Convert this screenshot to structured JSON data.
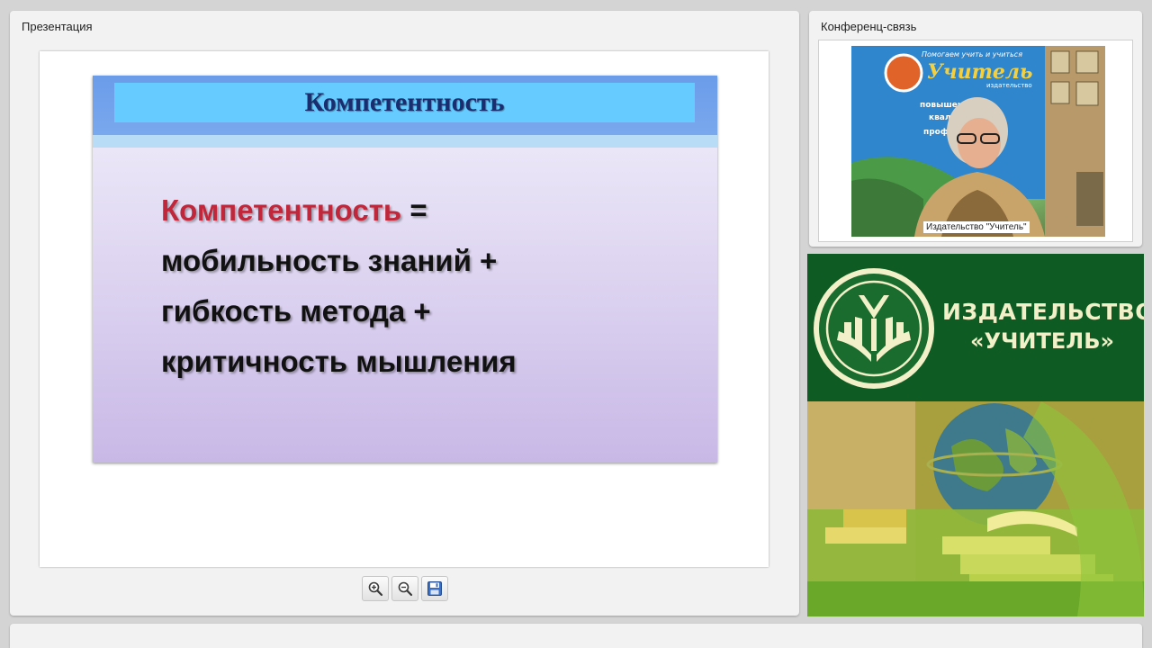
{
  "presentation": {
    "title": "Презентация",
    "slide": {
      "title": "Компетентность",
      "lines": [
        {
          "accent": "Компетентность",
          "text": " ="
        },
        {
          "text": "мобильность знаний +"
        },
        {
          "text": "гибкость метода +"
        },
        {
          "text": "критичность мышления"
        }
      ]
    },
    "toolbar": {
      "zoom_in_icon": "zoom-in-icon",
      "zoom_out_icon": "zoom-out-icon",
      "save_icon": "save-icon"
    }
  },
  "conference": {
    "title": "Конференц-связь",
    "caption": "Издательство \"Учитель\"",
    "backdrop_lines": [
      "Помогаем учить и учиться",
      "Учитель",
      "издательство",
      "повышение",
      "квали",
      "профе"
    ]
  },
  "banner": {
    "line1": "ИЗДАТЕЛЬСТВО",
    "line2": "«УЧИТЕЛЬ»"
  },
  "colors": {
    "slide_header": "#6a9ce8",
    "slide_title_box": "#66ccff",
    "slide_title_text": "#1a2d6e",
    "accent_text": "#c1273a",
    "banner_green": "#0e5c24",
    "banner_text": "#f2f0c8"
  }
}
